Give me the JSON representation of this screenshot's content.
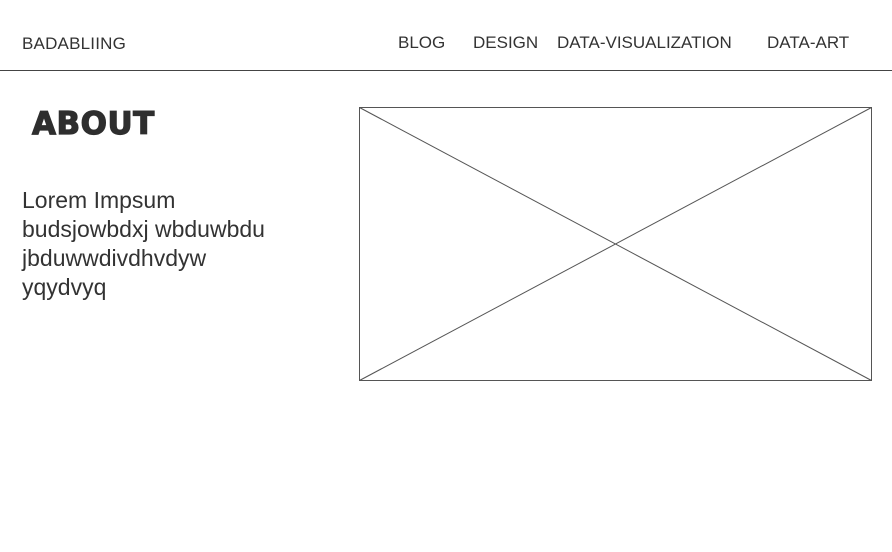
{
  "header": {
    "brand": "BADABLIING",
    "nav": [
      {
        "label": "BLOG"
      },
      {
        "label": "DESIGN"
      },
      {
        "label": "DATA-VISUALIZATION"
      },
      {
        "label": "DATA-ART"
      }
    ]
  },
  "about": {
    "heading": "ABOUT",
    "lines": [
      "Lorem Impsum",
      "budsjowbdxj wbduwbdu",
      "jbduwwdivdhvdyw",
      "yqydvyq"
    ]
  },
  "image_placeholder": {
    "icon": "image-placeholder-x"
  }
}
